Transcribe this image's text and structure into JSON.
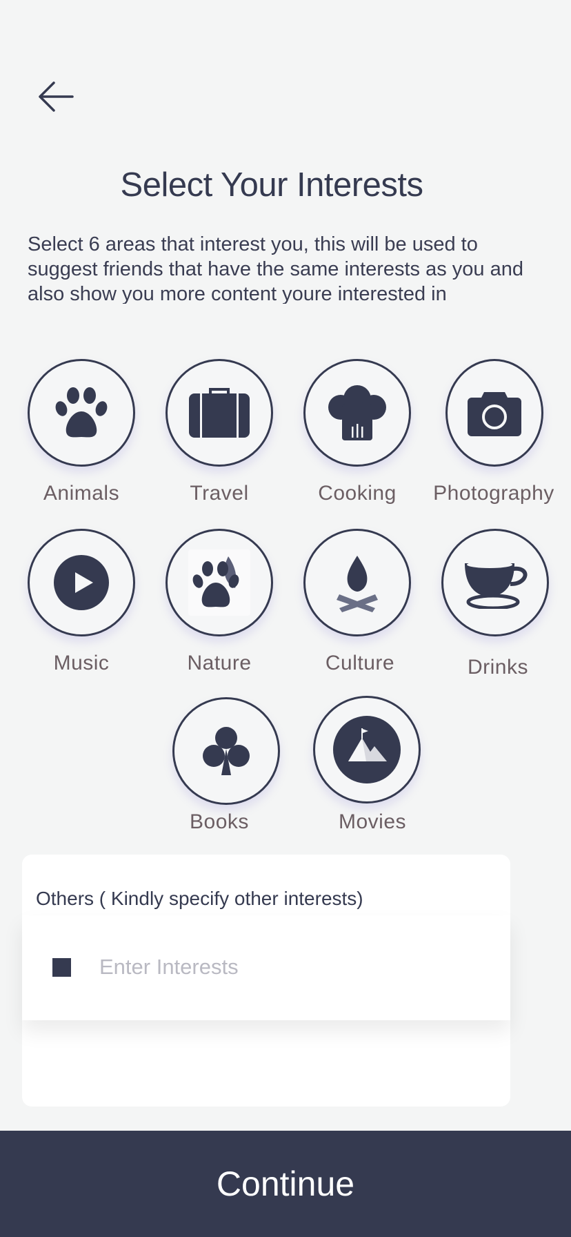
{
  "header": {
    "title": "Select Your Interests",
    "description": "Select 6 areas that interest you, this will be used to suggest friends that have the same interests as you and also show you more content youre interested in"
  },
  "interests": [
    {
      "label": "Animals",
      "icon": "paw-icon",
      "selected": false
    },
    {
      "label": "Travel",
      "icon": "suitcase-icon",
      "selected": false
    },
    {
      "label": "Cooking",
      "icon": "chef-hat-icon",
      "selected": false
    },
    {
      "label": "Photography",
      "icon": "camera-icon",
      "selected": false
    },
    {
      "label": "Music",
      "icon": "play-icon",
      "selected": false
    },
    {
      "label": "Nature",
      "icon": "paw-leaf-icon",
      "selected": false
    },
    {
      "label": "Culture",
      "icon": "campfire-icon",
      "selected": false
    },
    {
      "label": "Drinks",
      "icon": "coffee-cup-icon",
      "selected": false
    },
    {
      "label": "Books",
      "icon": "club-icon",
      "selected": false
    },
    {
      "label": "Movies",
      "icon": "mountain-flag-icon",
      "selected": true
    }
  ],
  "others": {
    "header": "Others ( Kindly specify other interests)",
    "placeholder": "Enter Interests",
    "value": ""
  },
  "footer": {
    "continue_label": "Continue"
  },
  "colors": {
    "primary": "#353a50",
    "background": "#f4f5f5",
    "label": "#6b5e63",
    "placeholder": "#b9b9c2"
  }
}
